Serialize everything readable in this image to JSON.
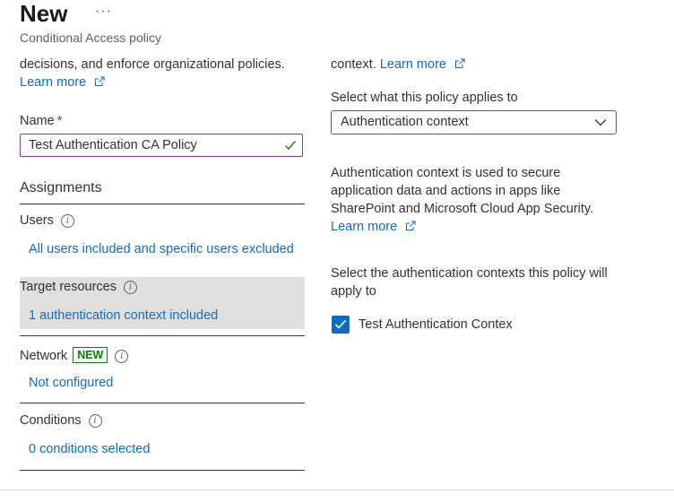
{
  "header": {
    "title": "New",
    "more_label": "···",
    "subtitle": "Conditional Access policy"
  },
  "left": {
    "intro_text": "decisions, and enforce organizational policies.",
    "intro_link": "Learn more",
    "name_label": "Name",
    "name_required": "*",
    "name_value": "Test Authentication CA Policy",
    "assignments_heading": "Assignments",
    "users_label": "Users",
    "users_link": "All users included and specific users excluded",
    "target_label": "Target resources",
    "target_link": "1 authentication context included",
    "network_label": "Network",
    "network_badge": "NEW",
    "network_link": "Not configured",
    "conditions_label": "Conditions",
    "conditions_link": "0 conditions selected"
  },
  "right": {
    "context_text": "context.",
    "context_link": "Learn more",
    "applies_label": "Select what this policy applies to",
    "applies_value": "Authentication context",
    "desc_line1": "Authentication context is used to secure",
    "desc_line2": "application data and actions in apps like",
    "desc_line3": "SharePoint and Microsoft Cloud App Security.",
    "desc_link": "Learn more",
    "select_label_line1": "Select the authentication contexts this policy will",
    "select_label_line2": "apply to",
    "checkbox_label": "Test Authentication Contex",
    "checkbox_checked": true
  },
  "icons": {
    "info": "info-icon",
    "external": "external-link-icon",
    "valid": "checkmark-icon",
    "dropdown": "chevron-down-icon"
  },
  "colors": {
    "link": "#0f6cbd",
    "focus_border": "#8a3a95",
    "badge": "#107c10",
    "highlight_bg": "#e1dfdd"
  }
}
